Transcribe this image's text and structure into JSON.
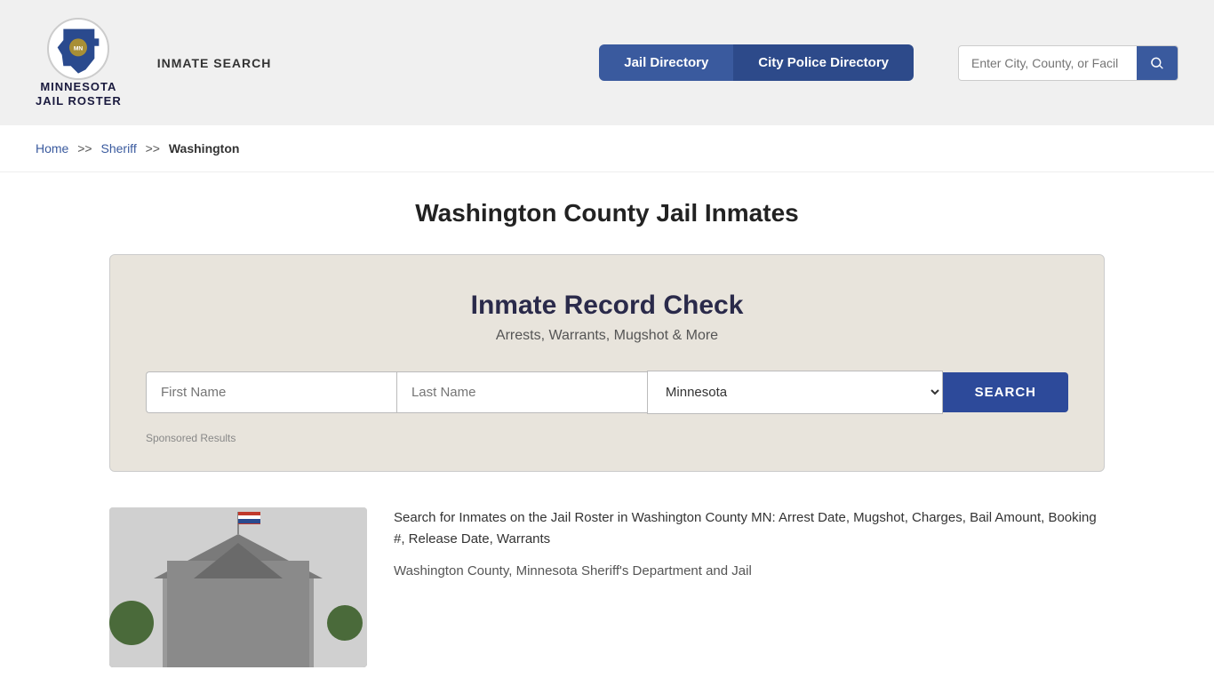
{
  "site": {
    "title_line1": "MINNESOTA",
    "title_line2": "JAIL ROSTER",
    "inmate_search": "INMATE SEARCH"
  },
  "nav": {
    "jail_directory": "Jail Directory",
    "city_police": "City Police Directory",
    "search_placeholder": "Enter City, County, or Facil"
  },
  "breadcrumb": {
    "home": "Home",
    "sep1": ">>",
    "sheriff": "Sheriff",
    "sep2": ">>",
    "current": "Washington"
  },
  "page": {
    "title": "Washington County Jail Inmates"
  },
  "record_check": {
    "title": "Inmate Record Check",
    "subtitle": "Arrests, Warrants, Mugshot & More",
    "first_name_placeholder": "First Name",
    "last_name_placeholder": "Last Name",
    "state_default": "Minnesota",
    "search_button": "SEARCH",
    "sponsored": "Sponsored Results"
  },
  "bottom": {
    "desc1": "Search for Inmates on the Jail Roster in Washington County MN: Arrest Date, Mugshot, Charges, Bail Amount, Booking #, Release Date, Warrants",
    "desc2": "Washington County, Minnesota Sheriff's Department and Jail"
  },
  "colors": {
    "nav_blue": "#3a5a9e",
    "nav_dark": "#2d4a8a",
    "search_blue": "#2d4a9a",
    "link_blue": "#3a5a9e"
  }
}
